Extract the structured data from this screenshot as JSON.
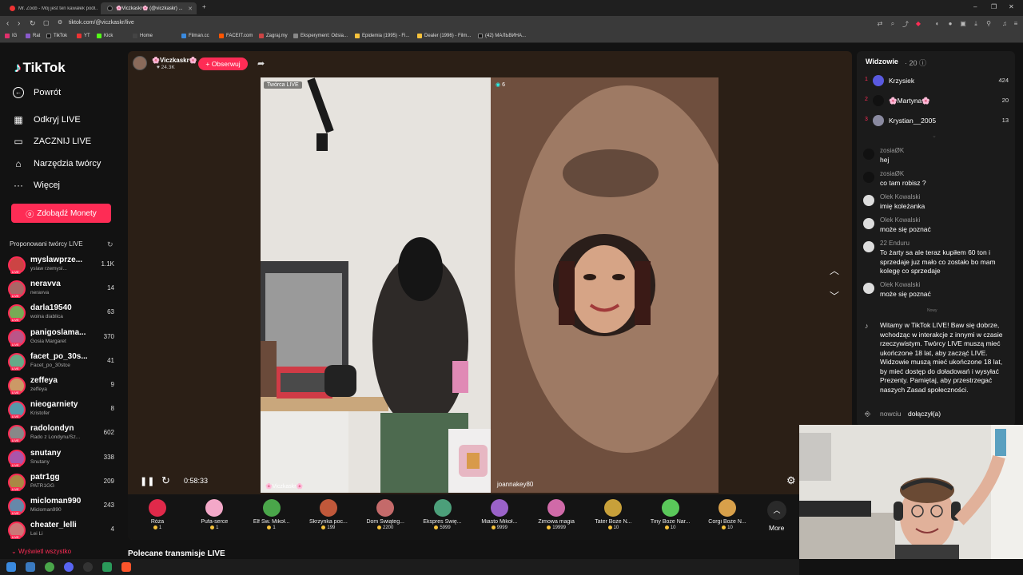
{
  "browser": {
    "tabs": [
      {
        "title": "Mr. Zoob - Mój jest ten kawałek podł..."
      },
      {
        "title": "🌸Viczkaskr🌸 (@viczkaskr) ..."
      }
    ],
    "new_tab": "+",
    "window_controls": [
      "–",
      "❐",
      "✕"
    ],
    "url": "tiktok.com/@viczkaskr/live",
    "bookmarks": [
      "IG",
      "Rat",
      "TikTok",
      "YT",
      "Kick",
      "Home",
      "Filman.cc",
      "FACEIT.com",
      "Zagraj.my",
      "Eksperyment: Odsia...",
      "Epidemia (1995) - Fi...",
      "Dealer (1996) - Film...",
      "(42) МАЛЬВИНА..."
    ],
    "colors": {
      "accent": "#fe2c55",
      "teal": "#25f4ee"
    }
  },
  "sidebar": {
    "logo": "TikTok",
    "nav": [
      {
        "label": "Powrót",
        "icon": "arrow-left-icon"
      },
      {
        "label": "Odkryj LIVE",
        "icon": "calendar-icon"
      },
      {
        "label": "ZACZNIJ LIVE",
        "icon": "video-camera-icon"
      },
      {
        "label": "Narzędzia twórcy",
        "icon": "home-icon"
      },
      {
        "label": "Więcej",
        "icon": "more-dots-icon"
      }
    ],
    "coins_button": "Zdobądź Monety",
    "suggested_title": "Proponowani twórcy LIVE",
    "live_badge": "LIVE",
    "creators": [
      {
        "name": "myslawprze...",
        "sub": "yslaw rzemysl...",
        "count": "1.1K"
      },
      {
        "name": "neravva",
        "sub": "neravva",
        "count": "14"
      },
      {
        "name": "darla19540",
        "sub": "woina diablica",
        "count": "63"
      },
      {
        "name": "panigoslama...",
        "sub": "Gosia Margaret",
        "count": "370"
      },
      {
        "name": "facet_po_30s...",
        "sub": "Facet_po_30stce",
        "count": "41"
      },
      {
        "name": "zeffeya",
        "sub": "zeffeya",
        "count": "9"
      },
      {
        "name": "nieogarniety",
        "sub": "Kristofer",
        "count": "8"
      },
      {
        "name": "radolondyn",
        "sub": "Rado z Londynu/Sz...",
        "count": "602"
      },
      {
        "name": "snutany",
        "sub": "Snutany",
        "count": "338"
      },
      {
        "name": "patr1gg",
        "sub": "PATR1GG",
        "count": "209"
      },
      {
        "name": "micloman990",
        "sub": "Micloman990",
        "count": "243"
      },
      {
        "name": "cheater_lelli",
        "sub": "Lei Li",
        "count": "4"
      }
    ],
    "show_all": "Wyświetl wszystko"
  },
  "stream": {
    "host_name": "🌸Viczkaskr🌸",
    "host_likes": "24.3K",
    "follow": "+ Obserwuj",
    "creator_badge": "Twórca LIVE",
    "viewers_small": "6",
    "left_tag": "🌸Viczkaskr🌸",
    "right_tag": "joannakey80",
    "timer": "0:58:33"
  },
  "gifts": [
    {
      "name": "Róża",
      "price": "1",
      "color": "#e0294a"
    },
    {
      "name": "Pufa-serce",
      "price": "1",
      "color": "#f3a8c8"
    },
    {
      "name": "Elf Św. Mikoł...",
      "price": "1",
      "color": "#4aa64a"
    },
    {
      "name": "Skrzynka poc...",
      "price": "199",
      "color": "#c0583a"
    },
    {
      "name": "Dom Świąteg...",
      "price": "2200",
      "color": "#c46a6a"
    },
    {
      "name": "Ekspres Świę...",
      "price": "5999",
      "color": "#4c9f7a"
    },
    {
      "name": "Miasto Mikoł...",
      "price": "9999",
      "color": "#9a62c8"
    },
    {
      "name": "Zimowa magia",
      "price": "19999",
      "color": "#d06aa8"
    },
    {
      "name": "Tater Boże N...",
      "price": "10",
      "color": "#c8a03a"
    },
    {
      "name": "Tiny Boże Nar...",
      "price": "10",
      "color": "#5ac85a"
    },
    {
      "name": "Corgi Boże N...",
      "price": "10",
      "color": "#d8a04a"
    }
  ],
  "more": "More",
  "recommended": "Polecane transmisje LIVE",
  "panel": {
    "viewers_title": "Widzowie",
    "viewers_count": "· 20",
    "top": [
      {
        "rank": "1",
        "name": "Krzysiek",
        "score": "424"
      },
      {
        "rank": "2",
        "name": "🌸Martyna🌸",
        "score": "20"
      },
      {
        "rank": "3",
        "name": "Krystian__2005",
        "score": "13"
      }
    ],
    "chat": [
      {
        "user": "zosiaØK",
        "msg": "hej"
      },
      {
        "user": "zosiaØK",
        "msg": "co tam robisz ?"
      },
      {
        "user": "Olek Kowalski",
        "msg": "imię koleżanka"
      },
      {
        "user": "Olek Kowalski",
        "msg": "może się poznać"
      },
      {
        "user": "22 Enduru",
        "msg": "To żarty sa ale teraz kupiłem 60 ton i sprzedaje juz mało co zostało bo mam kolegę co sprzedaje"
      },
      {
        "user": "Olek Kowalski",
        "msg": "może się poznać"
      }
    ],
    "new_tag": "Nowy",
    "welcome": "Witamy w TikTok LIVE! Baw się dobrze, wchodząc w interakcje z innymi w czasie rzeczywistym. Twórcy LIVE muszą mieć ukończone 18 lat, aby zacząć LIVE. Widzowie muszą mieć ukończone 18 lat, by mieć dostęp do doładowań i wysyłać Prezenty. Pamiętaj, aby przestrzegać naszych Zasad społeczności.",
    "join_user": "nowciu",
    "join_msg": "dołączył(a)"
  }
}
